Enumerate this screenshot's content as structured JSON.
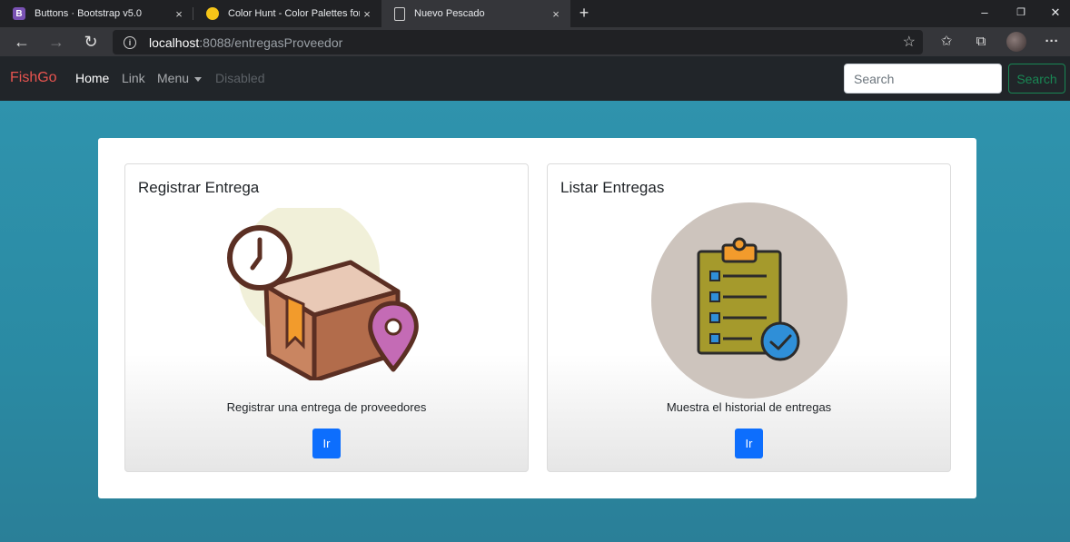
{
  "browser": {
    "tabs": [
      {
        "title": "Buttons · Bootstrap v5.0",
        "favicon_letter": "B",
        "active": false
      },
      {
        "title": "Color Hunt - Color Palettes for D",
        "favicon_letter": "",
        "active": false
      },
      {
        "title": "Nuevo Pescado",
        "favicon_letter": "",
        "active": true
      }
    ],
    "url_host": "localhost",
    "url_path": ":8088/entregasProveedor",
    "new_tab_glyph": "+",
    "minimize_glyph": "–",
    "restore_glyph": "❐",
    "close_glyph": "✕",
    "back_glyph": "←",
    "forward_glyph": "→",
    "reload_glyph": "↻",
    "star_glyph": "☆",
    "favorites_glyph": "✩",
    "collections_glyph": "⧉",
    "more_glyph": "···",
    "info_glyph": "i",
    "tab_close_glyph": "×"
  },
  "navbar": {
    "brand": "FishGo",
    "links": {
      "home": "Home",
      "link": "Link",
      "menu": "Menu",
      "disabled": "Disabled"
    },
    "search_placeholder": "Search",
    "search_button": "Search"
  },
  "cards": [
    {
      "title": "Registrar Entrega",
      "text": "Registrar una entrega de proveedores",
      "button": "Ir"
    },
    {
      "title": "Listar Entregas",
      "text": "Muestra el historial de entregas",
      "button": "Ir"
    }
  ],
  "colors": {
    "brand": "#e8544f",
    "page_bg": "#2a8aa3",
    "primary_button": "#0d6efd",
    "success_outline": "#198754"
  }
}
